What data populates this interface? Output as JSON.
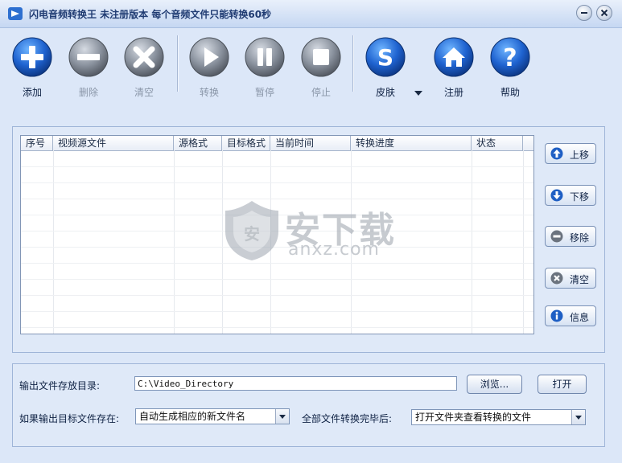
{
  "window": {
    "title": "闪电音频转换王  未注册版本 每个音频文件只能转换60秒"
  },
  "toolbar": {
    "add": "添加",
    "delete": "删除",
    "clear": "清空",
    "convert": "转换",
    "pause": "暂停",
    "stop": "停止",
    "skin": "皮肤",
    "register": "注册",
    "help": "帮助"
  },
  "table": {
    "columns": [
      "序号",
      "视频源文件",
      "源格式",
      "目标格式",
      "当前时间",
      "转换进度",
      "状态"
    ]
  },
  "side": {
    "move_up": "上移",
    "move_down": "下移",
    "remove": "移除",
    "clear": "清空",
    "info": "信息"
  },
  "watermark": {
    "logo_cn": "安下载",
    "logo_en": "anxz.com"
  },
  "output": {
    "dir_label": "输出文件存放目录:",
    "dir_value": "C:\\Video_Directory",
    "browse": "浏览...",
    "open": "打开",
    "exists_label": "如果输出目标文件存在:",
    "exists_value": "自动生成相应的新文件名",
    "after_label": "全部文件转换完毕后:",
    "after_value": "打开文件夹查看转换的文件"
  },
  "colors": {
    "accent_blue": "#1f5fc4",
    "disabled_gray": "#7e8794"
  }
}
